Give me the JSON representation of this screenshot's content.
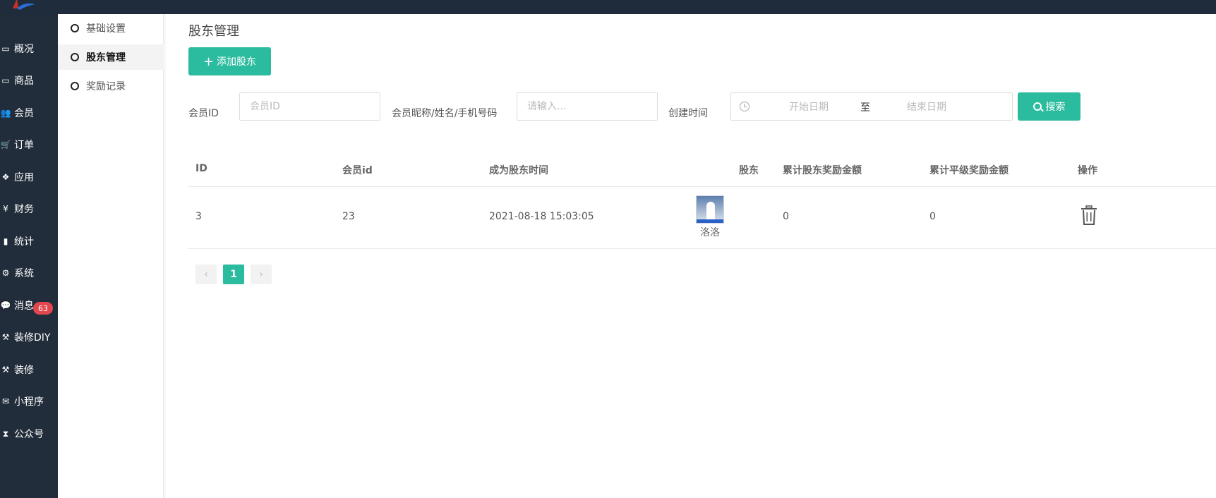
{
  "colors": {
    "accent": "#2bbb9e",
    "sidebar": "#222d3b",
    "badge": "#e2474d"
  },
  "leftnav": [
    {
      "label": "概况",
      "icon": "window-icon"
    },
    {
      "label": "商品",
      "icon": "window-icon"
    },
    {
      "label": "会员",
      "icon": "users-icon"
    },
    {
      "label": "订单",
      "icon": "cart-icon"
    },
    {
      "label": "应用",
      "icon": "cubes-icon"
    },
    {
      "label": "财务",
      "icon": "yen-icon"
    },
    {
      "label": "统计",
      "icon": "bar-chart-icon"
    },
    {
      "label": "系统",
      "icon": "gears-icon"
    },
    {
      "label": "消息",
      "icon": "chat-icon"
    },
    {
      "label": "装修DIY",
      "icon": "gavel-icon"
    },
    {
      "label": "装修",
      "icon": "gavel-icon"
    },
    {
      "label": "小程序",
      "icon": "wechat-icon"
    },
    {
      "label": "公众号",
      "icon": "hourglass-icon"
    }
  ],
  "message_badge": "63",
  "subnav": [
    {
      "label": "基础设置",
      "active": false
    },
    {
      "label": "股东管理",
      "active": true
    },
    {
      "label": "奖励记录",
      "active": false
    }
  ],
  "page": {
    "title": "股东管理",
    "add_button": "添加股东",
    "add_button_icon": "+"
  },
  "filters": {
    "member_id_label": "会员ID",
    "member_id_placeholder": "会员ID",
    "keyword_label": "会员昵称/姓名/手机号码",
    "keyword_placeholder": "请输入...",
    "time_label": "创建时间",
    "start_placeholder": "开始日期",
    "range_sep": "至",
    "end_placeholder": "结束日期",
    "search_button": "搜索"
  },
  "table": {
    "headers": [
      "ID",
      "会员id",
      "成为股东时间",
      "股东",
      "累计股东奖励金额",
      "累计平级奖励金额",
      "操作"
    ],
    "rows": [
      {
        "id": "3",
        "member_id": "23",
        "time": "2021-08-18 15:03:05",
        "name": "洛洛",
        "shareholder_reward": "0",
        "peer_reward": "0"
      }
    ]
  },
  "pagination": {
    "prev": "‹",
    "current": "1",
    "next": "›"
  }
}
